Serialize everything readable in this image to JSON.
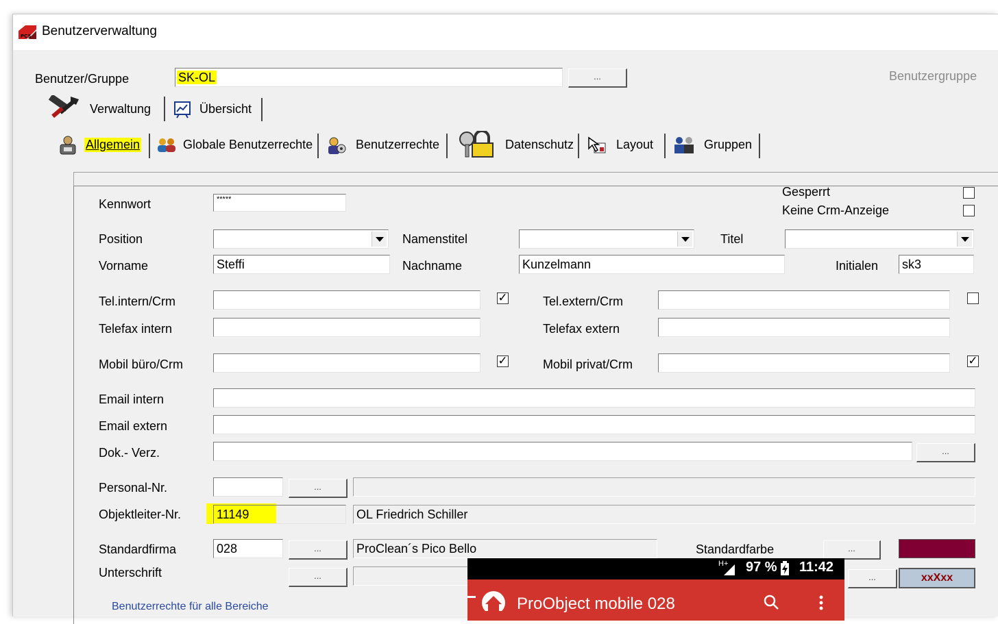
{
  "window": {
    "title": "Benutzerverwaltung"
  },
  "header": {
    "user_group_label": "Benutzer/Gruppe",
    "user_group_value": "SK-OL",
    "browse_label": "...",
    "group_hint": "Benutzergruppe"
  },
  "main_tabs": [
    {
      "label": "Verwaltung"
    },
    {
      "label": "Übersicht"
    }
  ],
  "sub_tabs": [
    {
      "label": "Allgemein"
    },
    {
      "label": "Globale Benutzerrechte"
    },
    {
      "label": "Benutzerrechte"
    },
    {
      "label": "Datenschutz"
    },
    {
      "label": "Layout"
    },
    {
      "label": "Gruppen"
    }
  ],
  "form": {
    "kennwort_label": "Kennwort",
    "kennwort_value": "*****",
    "gesperrt_label": "Gesperrt",
    "keine_crm_label": "Keine Crm-Anzeige",
    "position_label": "Position",
    "namenstitel_label": "Namenstitel",
    "titel_label": "Titel",
    "vorname_label": "Vorname",
    "vorname_value": "Steffi",
    "nachname_label": "Nachname",
    "nachname_value": "Kunzelmann",
    "initialen_label": "Initialen",
    "initialen_value": "sk3",
    "tel_intern_label": "Tel.intern/Crm",
    "tel_extern_label": "Tel.extern/Crm",
    "telefax_intern_label": "Telefax intern",
    "telefax_extern_label": "Telefax extern",
    "mobil_buero_label": "Mobil büro/Crm",
    "mobil_privat_label": "Mobil privat/Crm",
    "email_intern_label": "Email intern",
    "email_extern_label": "Email extern",
    "dok_verz_label": "Dok.- Verz.",
    "personal_nr_label": "Personal-Nr.",
    "objektleiter_label": "Objektleiter-Nr.",
    "objektleiter_value": "11149",
    "objektleiter_name": "OL Friedrich Schiller",
    "standardfirma_label": "Standardfirma",
    "standardfirma_value": "028",
    "standardfirma_name": "ProClean´s Pico Bello",
    "standardfarbe_label": "Standardfarbe",
    "standardfarbe_color": "#800033",
    "unterschrift_label": "Unterschrift",
    "sample_text": "xxXxx",
    "rights_link": "Benutzerrechte für alle Bereiche"
  },
  "phone": {
    "signal": "H+",
    "battery": "97 %",
    "time": "11:42",
    "app_title": "ProObject mobile 028"
  }
}
